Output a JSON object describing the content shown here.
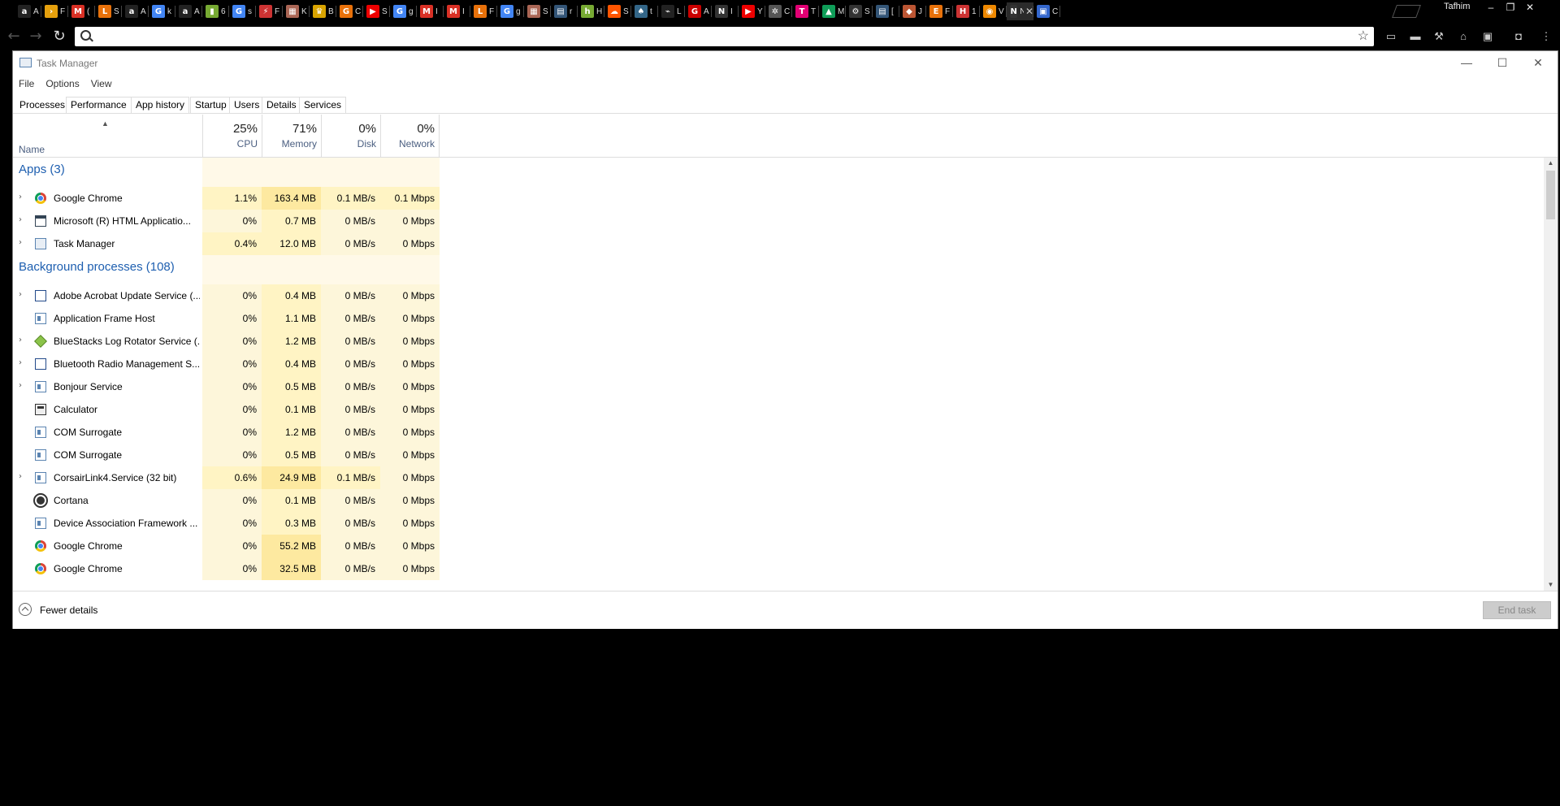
{
  "browser": {
    "profile_name": "Tafhim",
    "omnibox": {
      "value": "",
      "placeholder": ""
    },
    "tabs": [
      {
        "icon": "amazon-icon",
        "glyph": "a",
        "color": "#222",
        "label": "A"
      },
      {
        "icon": "plex-icon",
        "glyph": "›",
        "color": "#e5a00d",
        "label": "F"
      },
      {
        "icon": "gmail-icon",
        "glyph": "M",
        "color": "#d93025",
        "label": "("
      },
      {
        "icon": "l-icon",
        "glyph": "L",
        "color": "#e8710a",
        "label": "S"
      },
      {
        "icon": "amazon-icon",
        "glyph": "a",
        "color": "#222",
        "label": "A"
      },
      {
        "icon": "google-icon",
        "glyph": "G",
        "color": "#4285f4",
        "label": "k"
      },
      {
        "icon": "amazon-icon",
        "glyph": "a",
        "color": "#222",
        "label": "A"
      },
      {
        "icon": "bar-icon",
        "glyph": "▮",
        "color": "#7a3",
        "label": "6"
      },
      {
        "icon": "google-icon",
        "glyph": "G",
        "color": "#4285f4",
        "label": "s"
      },
      {
        "icon": "bolt-icon",
        "glyph": "⚡",
        "color": "#c33",
        "label": "F"
      },
      {
        "icon": "image-icon",
        "glyph": "▦",
        "color": "#a65",
        "label": "K"
      },
      {
        "icon": "crown-icon",
        "glyph": "♛",
        "color": "#d9a400",
        "label": "B"
      },
      {
        "icon": "g-icon",
        "glyph": "G",
        "color": "#e8710a",
        "label": "C"
      },
      {
        "icon": "youtube-icon",
        "glyph": "▶",
        "color": "#e00",
        "label": "S"
      },
      {
        "icon": "google-icon",
        "glyph": "G",
        "color": "#4285f4",
        "label": "g"
      },
      {
        "icon": "gmail-icon",
        "glyph": "M",
        "color": "#d93025",
        "label": "I"
      },
      {
        "icon": "gmail-icon",
        "glyph": "M",
        "color": "#d93025",
        "label": "I"
      },
      {
        "icon": "l-icon",
        "glyph": "L",
        "color": "#e8710a",
        "label": "F"
      },
      {
        "icon": "google-icon",
        "glyph": "G",
        "color": "#4285f4",
        "label": "g"
      },
      {
        "icon": "image-icon",
        "glyph": "▦",
        "color": "#a65",
        "label": "S"
      },
      {
        "icon": "reader-icon",
        "glyph": "▤",
        "color": "#357",
        "label": "r"
      },
      {
        "icon": "h-icon",
        "glyph": "h",
        "color": "#7a3",
        "label": "H"
      },
      {
        "icon": "soundcloud-icon",
        "glyph": "☁",
        "color": "#f50",
        "label": "S"
      },
      {
        "icon": "bird-icon",
        "glyph": "♠",
        "color": "#368",
        "label": "t"
      },
      {
        "icon": "code-icon",
        "glyph": "⌁",
        "color": "#222",
        "label": "L"
      },
      {
        "icon": "g2a-icon",
        "glyph": "G",
        "color": "#c00",
        "label": "A"
      },
      {
        "icon": "n-icon",
        "glyph": "N",
        "color": "#333",
        "label": "I"
      },
      {
        "icon": "youtube-icon",
        "glyph": "▶",
        "color": "#e00",
        "label": "Y"
      },
      {
        "icon": "gear-icon",
        "glyph": "✲",
        "color": "#555",
        "label": "C"
      },
      {
        "icon": "tmobile-icon",
        "glyph": "T",
        "color": "#e20074",
        "label": "T"
      },
      {
        "icon": "drive-icon",
        "glyph": "▲",
        "color": "#0f9d58",
        "label": "M"
      },
      {
        "icon": "steam-icon",
        "glyph": "⚙",
        "color": "#333",
        "label": "S"
      },
      {
        "icon": "reader-icon",
        "glyph": "▤",
        "color": "#357",
        "label": "["
      },
      {
        "icon": "shield-icon",
        "glyph": "◆",
        "color": "#b53",
        "label": "J"
      },
      {
        "icon": "e-icon",
        "glyph": "E",
        "color": "#e8710a",
        "label": "F"
      },
      {
        "icon": "h-icon",
        "glyph": "H",
        "color": "#c33",
        "label": "1"
      },
      {
        "icon": "record-icon",
        "glyph": "◉",
        "color": "#e80",
        "label": "V"
      },
      {
        "icon": "n-icon",
        "glyph": "N",
        "color": "#333",
        "label": "N",
        "active": true
      },
      {
        "icon": "square-icon",
        "glyph": "▣",
        "color": "#36c",
        "label": "C"
      }
    ],
    "extensions": [
      {
        "name": "cast-icon",
        "glyph": "▭"
      },
      {
        "name": "pocket-icon",
        "glyph": "▬"
      },
      {
        "name": "hammer-icon",
        "glyph": "⚒"
      },
      {
        "name": "off-badge-icon",
        "glyph": "⌂"
      },
      {
        "name": "screen-icon",
        "glyph": "▣"
      },
      {
        "name": "ublock-icon",
        "glyph": "◘"
      },
      {
        "name": "menu-dots-icon",
        "glyph": "⋮"
      }
    ]
  },
  "task_manager": {
    "title": "Task Manager",
    "menu": [
      "File",
      "Options",
      "View"
    ],
    "tabs": [
      "Processes",
      "Performance",
      "App history",
      "Startup",
      "Users",
      "Details",
      "Services"
    ],
    "columns": {
      "name": "Name",
      "cpu": {
        "percent": "25%",
        "label": "CPU"
      },
      "memory": {
        "percent": "71%",
        "label": "Memory"
      },
      "disk": {
        "percent": "0%",
        "label": "Disk"
      },
      "network": {
        "percent": "0%",
        "label": "Network"
      }
    },
    "rows": [
      {
        "type": "group",
        "label": "Apps (3)"
      },
      {
        "type": "proc",
        "expand": true,
        "icon": "chrome",
        "name": "Google Chrome",
        "cpu": "1.1%",
        "mem": "163.4 MB",
        "disk": "0.1 MB/s",
        "net": "0.1 Mbps",
        "hl": 1
      },
      {
        "type": "proc",
        "expand": true,
        "icon": "window",
        "name": "Microsoft (R) HTML Applicatio...",
        "cpu": "0%",
        "mem": "0.7 MB",
        "disk": "0 MB/s",
        "net": "0 Mbps",
        "hl": 0
      },
      {
        "type": "proc",
        "expand": true,
        "icon": "tm",
        "name": "Task Manager",
        "cpu": "0.4%",
        "mem": "12.0 MB",
        "disk": "0 MB/s",
        "net": "0 Mbps",
        "hl": 1
      },
      {
        "type": "group",
        "label": "Background processes (108)"
      },
      {
        "type": "proc",
        "expand": true,
        "icon": "adobe",
        "name": "Adobe Acrobat Update Service (...",
        "cpu": "0%",
        "mem": "0.4 MB",
        "disk": "0 MB/s",
        "net": "0 Mbps",
        "hl": 0
      },
      {
        "type": "proc",
        "expand": false,
        "icon": "service",
        "name": "Application Frame Host",
        "cpu": "0%",
        "mem": "1.1 MB",
        "disk": "0 MB/s",
        "net": "0 Mbps",
        "hl": 0
      },
      {
        "type": "proc",
        "expand": true,
        "icon": "bluestacks",
        "name": "BlueStacks Log Rotator Service (...",
        "cpu": "0%",
        "mem": "1.2 MB",
        "disk": "0 MB/s",
        "net": "0 Mbps",
        "hl": 0
      },
      {
        "type": "proc",
        "expand": true,
        "icon": "adobe",
        "name": "Bluetooth Radio Management S...",
        "cpu": "0%",
        "mem": "0.4 MB",
        "disk": "0 MB/s",
        "net": "0 Mbps",
        "hl": 0
      },
      {
        "type": "proc",
        "expand": true,
        "icon": "service",
        "name": "Bonjour Service",
        "cpu": "0%",
        "mem": "0.5 MB",
        "disk": "0 MB/s",
        "net": "0 Mbps",
        "hl": 0
      },
      {
        "type": "proc",
        "expand": false,
        "icon": "calc",
        "name": "Calculator",
        "cpu": "0%",
        "mem": "0.1 MB",
        "disk": "0 MB/s",
        "net": "0 Mbps",
        "hl": 0
      },
      {
        "type": "proc",
        "expand": false,
        "icon": "service",
        "name": "COM Surrogate",
        "cpu": "0%",
        "mem": "1.2 MB",
        "disk": "0 MB/s",
        "net": "0 Mbps",
        "hl": 0
      },
      {
        "type": "proc",
        "expand": false,
        "icon": "service",
        "name": "COM Surrogate",
        "cpu": "0%",
        "mem": "0.5 MB",
        "disk": "0 MB/s",
        "net": "0 Mbps",
        "hl": 0
      },
      {
        "type": "proc",
        "expand": true,
        "icon": "service",
        "name": "CorsairLink4.Service (32 bit)",
        "cpu": "0.6%",
        "mem": "24.9 MB",
        "disk": "0.1 MB/s",
        "net": "0 Mbps",
        "hl": 1
      },
      {
        "type": "proc",
        "expand": false,
        "icon": "cortana",
        "name": "Cortana",
        "cpu": "0%",
        "mem": "0.1 MB",
        "disk": "0 MB/s",
        "net": "0 Mbps",
        "hl": 0
      },
      {
        "type": "proc",
        "expand": false,
        "icon": "service",
        "name": "Device Association Framework ...",
        "cpu": "0%",
        "mem": "0.3 MB",
        "disk": "0 MB/s",
        "net": "0 Mbps",
        "hl": 0
      },
      {
        "type": "proc",
        "expand": false,
        "icon": "chrome",
        "name": "Google Chrome",
        "cpu": "0%",
        "mem": "55.2 MB",
        "disk": "0 MB/s",
        "net": "0 Mbps",
        "hl": 0
      },
      {
        "type": "proc",
        "expand": false,
        "icon": "chrome",
        "name": "Google Chrome",
        "cpu": "0%",
        "mem": "32.5 MB",
        "disk": "0 MB/s",
        "net": "0 Mbps",
        "hl": 0
      }
    ],
    "footer": {
      "fewer_details": "Fewer details",
      "end_task": "End task"
    }
  }
}
